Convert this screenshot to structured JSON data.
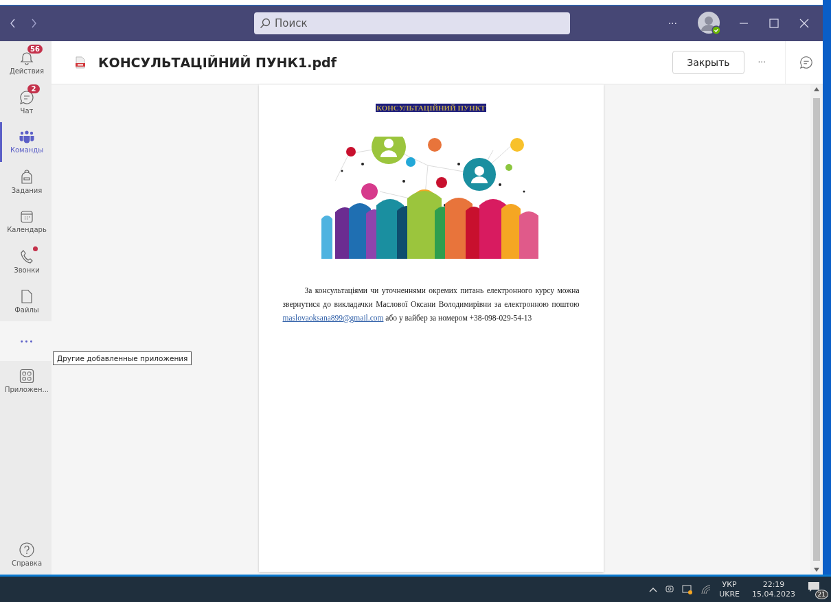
{
  "titlebar": {
    "search": {
      "placeholder": "Поиск"
    },
    "more": "···"
  },
  "sidebar": {
    "items": [
      {
        "kind": "activity",
        "label": "Действия",
        "badge": "56",
        "alert": false,
        "selected": false
      },
      {
        "kind": "chat",
        "label": "Чат",
        "badge": "2",
        "alert": false,
        "selected": false
      },
      {
        "kind": "teams",
        "label": "Команды",
        "alert": false,
        "selected": true
      },
      {
        "kind": "assignments",
        "label": "Задания",
        "alert": false,
        "selected": false
      },
      {
        "kind": "calendar",
        "label": "Календарь",
        "alert": false,
        "selected": false
      },
      {
        "kind": "calls",
        "label": "Звонки",
        "alert": true,
        "selected": false
      },
      {
        "kind": "files",
        "label": "Файлы",
        "alert": false,
        "selected": false
      },
      {
        "kind": "more",
        "label": "•••",
        "alert": false,
        "selected": false
      },
      {
        "kind": "apps",
        "label": "Приложен...",
        "alert": false,
        "selected": false
      }
    ],
    "help": "Справка",
    "tooltip": "Другие добавленные приложения"
  },
  "header": {
    "file_name": "КОНСУЛЬТАЦІЙНИЙ ПУНК1.pdf",
    "close_button": "Закрыть",
    "more": "···"
  },
  "document": {
    "title": "КОНСУЛЬТАЦІЙНИЙ ПУНКТ",
    "paragraph": {
      "text": "За консультаціями чи уточненнями окремих питань електронного курсу можна звернутися до викладачки Маслової Оксани Володимирівни за електронною поштою",
      "link": "maslovaoksana899@gmail.com",
      "text_after": "або у вайбер за номером +38-098-029-54-13"
    }
  },
  "taskbar": {
    "language": "УКР",
    "layout": "UKRE",
    "time": "22:19",
    "date": "15.04.2023",
    "notifications": "21"
  }
}
